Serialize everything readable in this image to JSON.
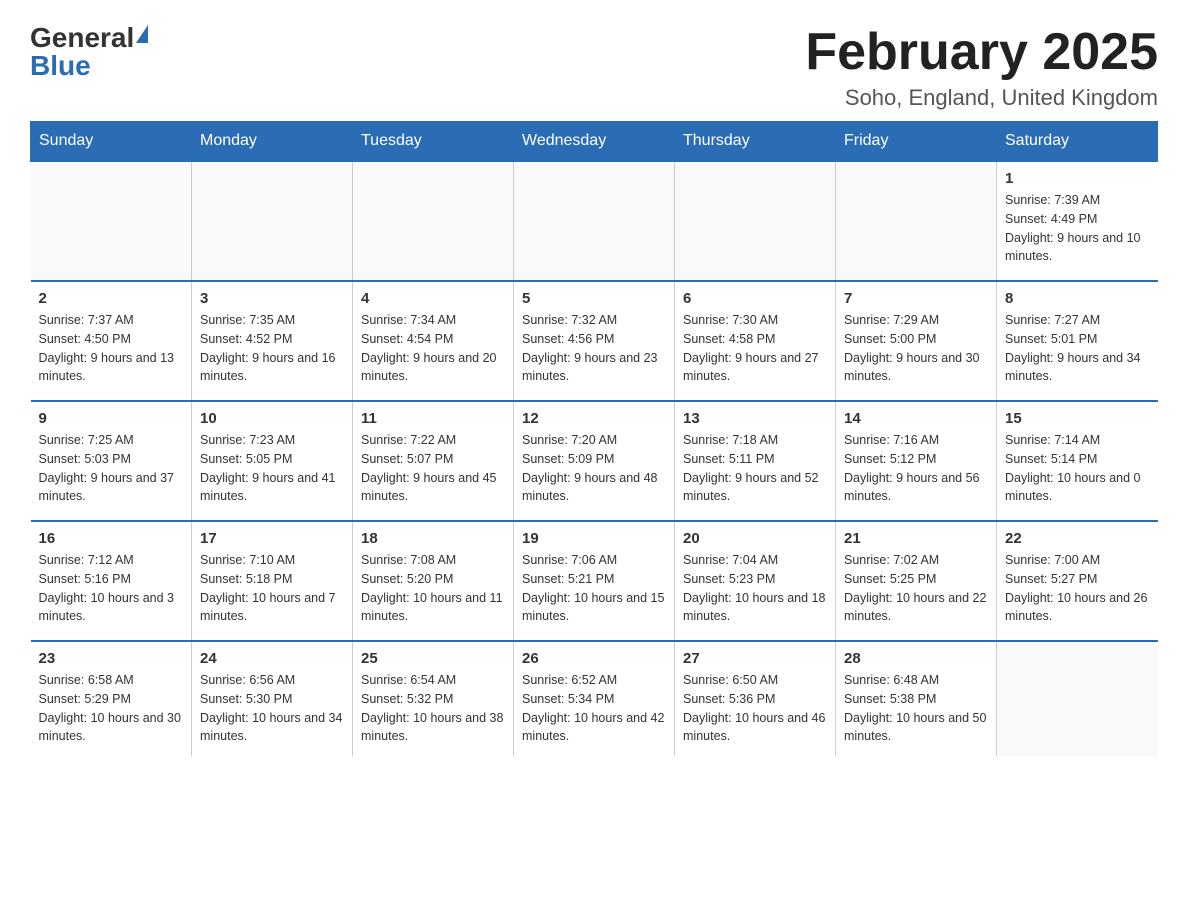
{
  "logo": {
    "general": "General",
    "blue": "Blue"
  },
  "header": {
    "title": "February 2025",
    "location": "Soho, England, United Kingdom"
  },
  "days_of_week": [
    "Sunday",
    "Monday",
    "Tuesday",
    "Wednesday",
    "Thursday",
    "Friday",
    "Saturday"
  ],
  "weeks": [
    [
      {
        "day": "",
        "info": ""
      },
      {
        "day": "",
        "info": ""
      },
      {
        "day": "",
        "info": ""
      },
      {
        "day": "",
        "info": ""
      },
      {
        "day": "",
        "info": ""
      },
      {
        "day": "",
        "info": ""
      },
      {
        "day": "1",
        "info": "Sunrise: 7:39 AM\nSunset: 4:49 PM\nDaylight: 9 hours and 10 minutes."
      }
    ],
    [
      {
        "day": "2",
        "info": "Sunrise: 7:37 AM\nSunset: 4:50 PM\nDaylight: 9 hours and 13 minutes."
      },
      {
        "day": "3",
        "info": "Sunrise: 7:35 AM\nSunset: 4:52 PM\nDaylight: 9 hours and 16 minutes."
      },
      {
        "day": "4",
        "info": "Sunrise: 7:34 AM\nSunset: 4:54 PM\nDaylight: 9 hours and 20 minutes."
      },
      {
        "day": "5",
        "info": "Sunrise: 7:32 AM\nSunset: 4:56 PM\nDaylight: 9 hours and 23 minutes."
      },
      {
        "day": "6",
        "info": "Sunrise: 7:30 AM\nSunset: 4:58 PM\nDaylight: 9 hours and 27 minutes."
      },
      {
        "day": "7",
        "info": "Sunrise: 7:29 AM\nSunset: 5:00 PM\nDaylight: 9 hours and 30 minutes."
      },
      {
        "day": "8",
        "info": "Sunrise: 7:27 AM\nSunset: 5:01 PM\nDaylight: 9 hours and 34 minutes."
      }
    ],
    [
      {
        "day": "9",
        "info": "Sunrise: 7:25 AM\nSunset: 5:03 PM\nDaylight: 9 hours and 37 minutes."
      },
      {
        "day": "10",
        "info": "Sunrise: 7:23 AM\nSunset: 5:05 PM\nDaylight: 9 hours and 41 minutes."
      },
      {
        "day": "11",
        "info": "Sunrise: 7:22 AM\nSunset: 5:07 PM\nDaylight: 9 hours and 45 minutes."
      },
      {
        "day": "12",
        "info": "Sunrise: 7:20 AM\nSunset: 5:09 PM\nDaylight: 9 hours and 48 minutes."
      },
      {
        "day": "13",
        "info": "Sunrise: 7:18 AM\nSunset: 5:11 PM\nDaylight: 9 hours and 52 minutes."
      },
      {
        "day": "14",
        "info": "Sunrise: 7:16 AM\nSunset: 5:12 PM\nDaylight: 9 hours and 56 minutes."
      },
      {
        "day": "15",
        "info": "Sunrise: 7:14 AM\nSunset: 5:14 PM\nDaylight: 10 hours and 0 minutes."
      }
    ],
    [
      {
        "day": "16",
        "info": "Sunrise: 7:12 AM\nSunset: 5:16 PM\nDaylight: 10 hours and 3 minutes."
      },
      {
        "day": "17",
        "info": "Sunrise: 7:10 AM\nSunset: 5:18 PM\nDaylight: 10 hours and 7 minutes."
      },
      {
        "day": "18",
        "info": "Sunrise: 7:08 AM\nSunset: 5:20 PM\nDaylight: 10 hours and 11 minutes."
      },
      {
        "day": "19",
        "info": "Sunrise: 7:06 AM\nSunset: 5:21 PM\nDaylight: 10 hours and 15 minutes."
      },
      {
        "day": "20",
        "info": "Sunrise: 7:04 AM\nSunset: 5:23 PM\nDaylight: 10 hours and 18 minutes."
      },
      {
        "day": "21",
        "info": "Sunrise: 7:02 AM\nSunset: 5:25 PM\nDaylight: 10 hours and 22 minutes."
      },
      {
        "day": "22",
        "info": "Sunrise: 7:00 AM\nSunset: 5:27 PM\nDaylight: 10 hours and 26 minutes."
      }
    ],
    [
      {
        "day": "23",
        "info": "Sunrise: 6:58 AM\nSunset: 5:29 PM\nDaylight: 10 hours and 30 minutes."
      },
      {
        "day": "24",
        "info": "Sunrise: 6:56 AM\nSunset: 5:30 PM\nDaylight: 10 hours and 34 minutes."
      },
      {
        "day": "25",
        "info": "Sunrise: 6:54 AM\nSunset: 5:32 PM\nDaylight: 10 hours and 38 minutes."
      },
      {
        "day": "26",
        "info": "Sunrise: 6:52 AM\nSunset: 5:34 PM\nDaylight: 10 hours and 42 minutes."
      },
      {
        "day": "27",
        "info": "Sunrise: 6:50 AM\nSunset: 5:36 PM\nDaylight: 10 hours and 46 minutes."
      },
      {
        "day": "28",
        "info": "Sunrise: 6:48 AM\nSunset: 5:38 PM\nDaylight: 10 hours and 50 minutes."
      },
      {
        "day": "",
        "info": ""
      }
    ]
  ]
}
